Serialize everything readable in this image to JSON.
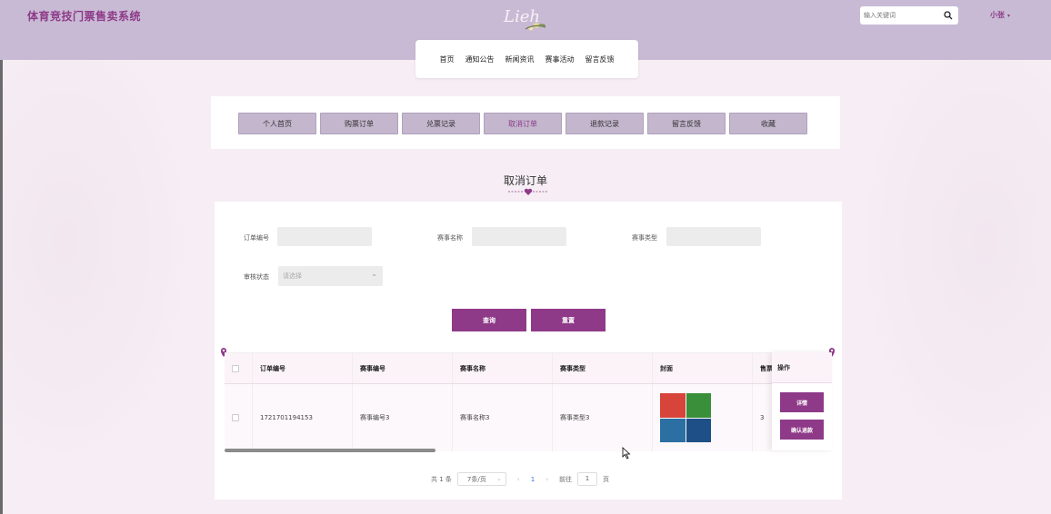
{
  "header": {
    "site_title": "体育竞技门票售卖系统",
    "search_placeholder": "输入关键词",
    "user_name": "小张",
    "user_caret": "▾"
  },
  "nav": {
    "items": [
      "首页",
      "通知公告",
      "新闻资讯",
      "赛事活动",
      "留言反馈"
    ]
  },
  "subnav": {
    "items": [
      "个人首页",
      "购票订单",
      "兑票记录",
      "取消订单",
      "退款记录",
      "留言反馈",
      "收藏"
    ],
    "active": "取消订单"
  },
  "page": {
    "heading": "取消订单"
  },
  "filters": {
    "order_no_label": "订单编号",
    "event_name_label": "赛事名称",
    "event_type_label": "赛事类型",
    "review_status_label": "审核状态",
    "review_status_placeholder": "请选择",
    "query_button": "查询",
    "reset_button": "重置"
  },
  "table": {
    "columns": [
      "订单编号",
      "赛事编号",
      "赛事名称",
      "赛事类型",
      "封面",
      "售票",
      "操作"
    ],
    "rows": [
      {
        "order_no": "1721701194153",
        "event_no": "赛事编号3",
        "event_name": "赛事名称3",
        "event_type": "赛事类型3",
        "ticket_count": "3"
      }
    ],
    "row_actions": {
      "detail": "详情",
      "confirm_refund": "确认退款"
    }
  },
  "pagination": {
    "total": "共 1 条",
    "page_size": "7条/页",
    "prev": "‹",
    "current_page": "1",
    "next": "›",
    "goto_label": "前往",
    "goto_value": "1",
    "page_unit": "页"
  },
  "colors": {
    "brand": "#8e3a88",
    "header_bg": "#c8bad4",
    "tab_bg": "#c3b6cd",
    "page_bg": "#f6eef4"
  }
}
